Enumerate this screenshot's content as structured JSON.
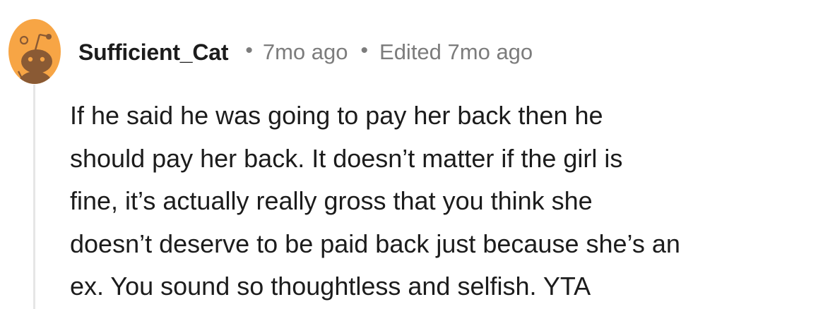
{
  "comment": {
    "author": "Sufficient_Cat",
    "separator": "•",
    "age": "7mo ago",
    "edited": "Edited 7mo ago",
    "avatar_icon": "snoo-avatar-icon",
    "body_lines": [
      "If he said he was going to pay her back then he",
      "should pay her back. It doesn’t matter if the girl is",
      "fine, it’s actually really gross that you think she",
      "doesn’t deserve to be paid back just because she’s an",
      "ex. You sound so thoughtless and selfish. YTA"
    ]
  },
  "colors": {
    "avatar_orange": "#f7a545",
    "avatar_brown": "#8a5a34",
    "meta_gray": "#7c7c7c",
    "thread_line": "#e6e6e6"
  }
}
